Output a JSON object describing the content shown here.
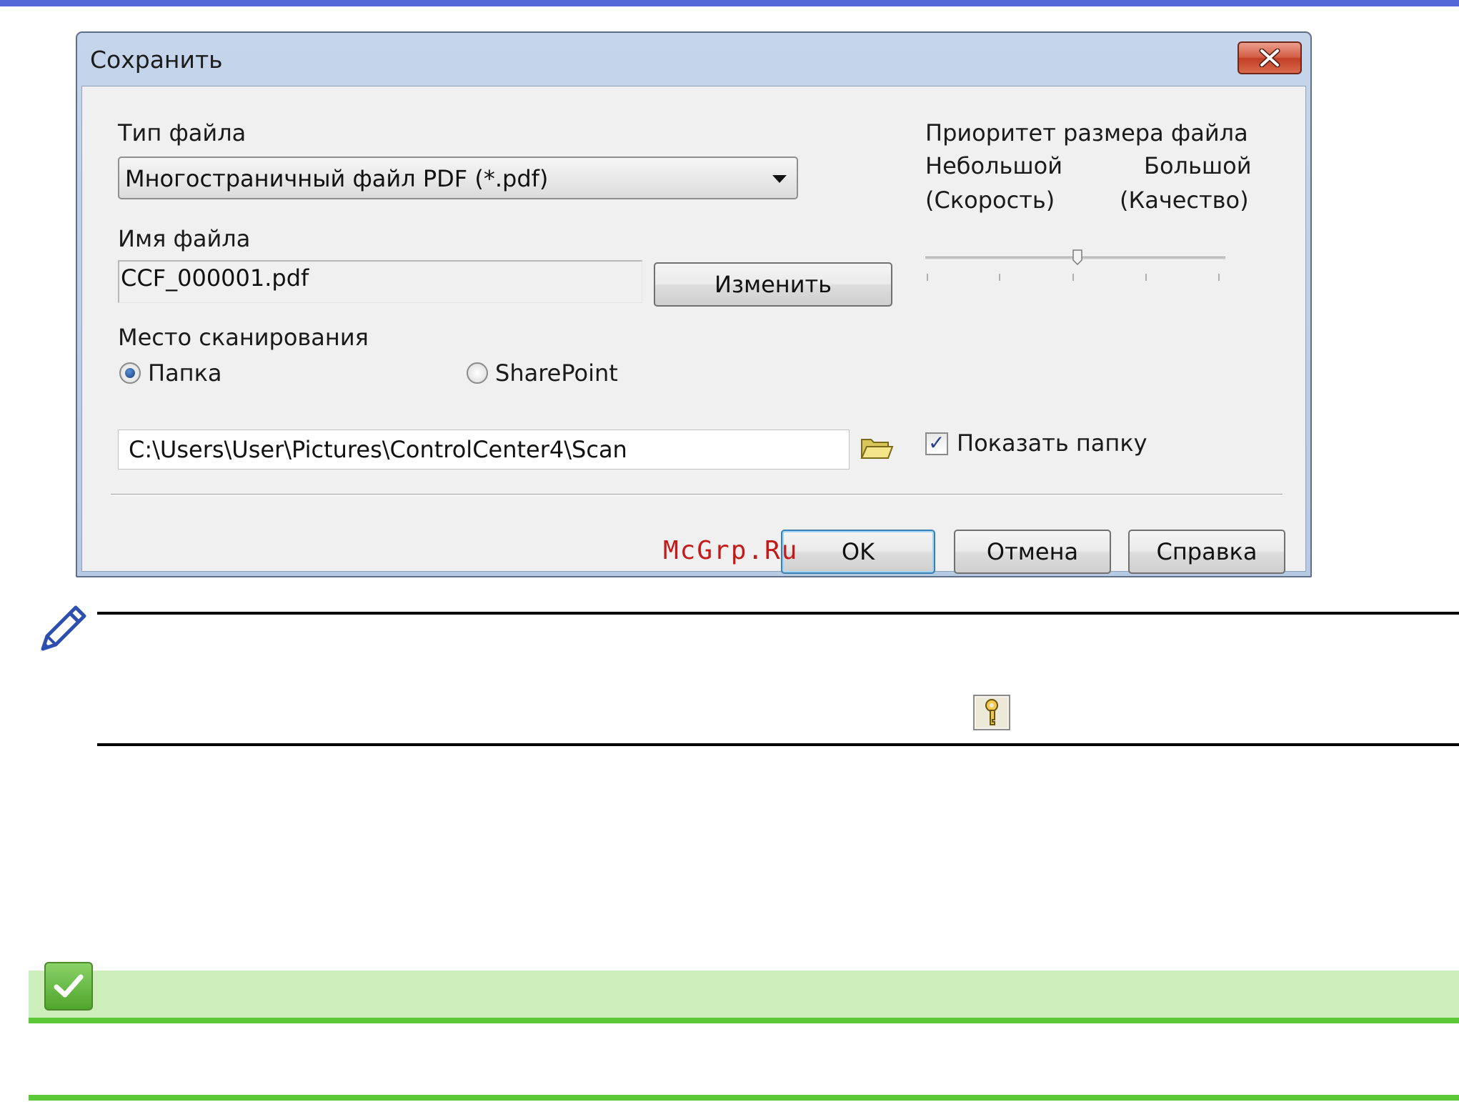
{
  "dialog": {
    "title": "Сохранить",
    "file_type": {
      "label": "Тип файла",
      "selected": "Многостраничный файл PDF (*.pdf)"
    },
    "file_name": {
      "label": "Имя файла",
      "value": "CCF_000001.pdf",
      "change_button": "Изменить"
    },
    "scan_location": {
      "label": "Место сканирования",
      "options": [
        {
          "label": "Папка",
          "checked": true
        },
        {
          "label": "SharePoint",
          "checked": false
        }
      ],
      "path": "C:\\Users\\User\\Pictures\\ControlCenter4\\Scan"
    },
    "show_folder": {
      "label": "Показать папку",
      "checked": true
    },
    "size_priority": {
      "label": "Приоритет размера файла",
      "left_label": "Небольшой",
      "left_sub": "(Скорость)",
      "right_label": "Большой",
      "right_sub": "(Качество)",
      "slider_value": 3,
      "slider_max": 5
    },
    "buttons": {
      "ok": "OK",
      "cancel": "Отмена",
      "help": "Справка"
    }
  },
  "watermark": "McGrp.Ru",
  "colors": {
    "header_bar": "#5468d8",
    "green_band": "#cbeeba",
    "green_line": "#5cc838"
  }
}
